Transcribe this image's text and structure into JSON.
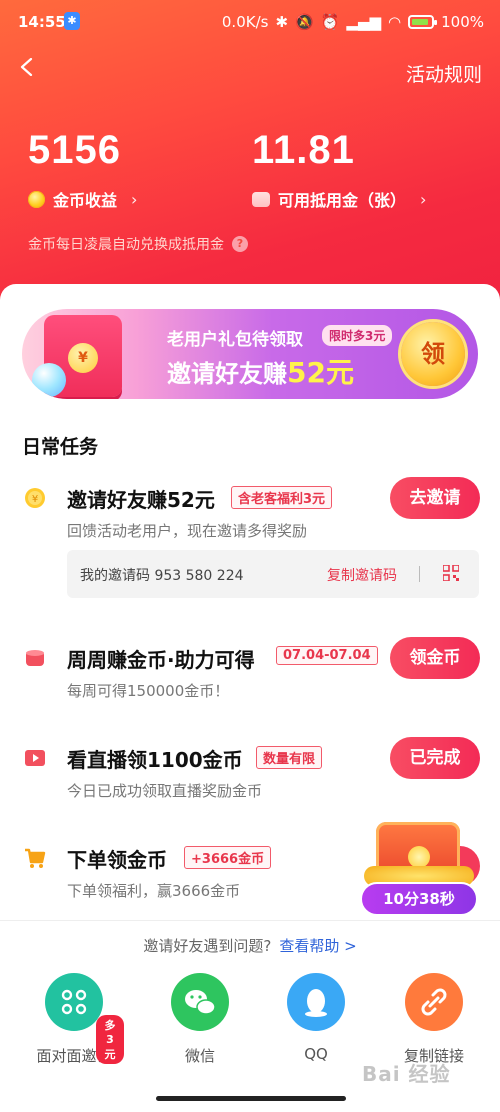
{
  "status_bar": {
    "time": "14:55",
    "net_speed": "0.0K/s",
    "battery": "100%"
  },
  "header": {
    "rules_label": "活动规则",
    "coins_value": "5156",
    "coins_label": "金币收益",
    "vouchers_value": "11.81",
    "vouchers_label": "可用抵用金（张）",
    "note": "金币每日凌晨自动兑换成抵用金"
  },
  "banner": {
    "line1": "老用户礼包待领取",
    "tag": "限时多3元",
    "line2_prefix": "邀请好友赚",
    "line2_amount": "52元",
    "claim_label": "领"
  },
  "daily": {
    "section_title": "日常任务",
    "tasks": [
      {
        "title": "邀请好友赚52元",
        "tag": "含老客福利3元",
        "desc": "回馈活动老用户，现在邀请多得奖励",
        "button": "去邀请"
      },
      {
        "title": "周周赚金币·助力可得",
        "tag": "07.04-07.04",
        "desc": "每周可得150000金币！",
        "button": "领金币"
      },
      {
        "title": "看直播领1100金币",
        "tag": "数量有限",
        "desc": "今日已成功领取直播奖励金币",
        "button": "已完成"
      },
      {
        "title": "下单领金币",
        "tag": "+3666金币",
        "desc": "下单领福利，赢3666金币",
        "button": ""
      }
    ],
    "invite_code_text": "我的邀请码 953 580 224",
    "copy_code_label": "复制邀请码"
  },
  "chest_timer": "10分38秒",
  "share": {
    "help_text": "邀请好友遇到问题?",
    "help_link": "查看帮助 >",
    "items": [
      {
        "label": "面对面邀请",
        "badge": "多3元",
        "icon": "grid-icon",
        "color": "#22c2a0"
      },
      {
        "label": "微信",
        "icon": "wechat-icon",
        "color": "#2ec55f"
      },
      {
        "label": "QQ",
        "icon": "qq-icon",
        "color": "#3aa8f5"
      },
      {
        "label": "复制链接",
        "icon": "link-icon",
        "color": "#ff7a3c"
      }
    ]
  },
  "watermark": "Bai 经验"
}
